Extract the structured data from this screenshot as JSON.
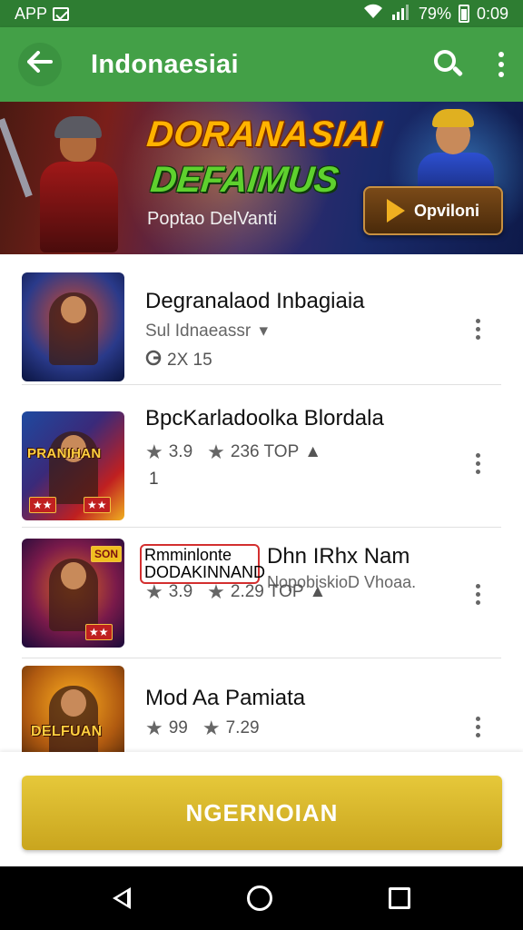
{
  "status_bar": {
    "left_text": "APP",
    "battery": "79%",
    "time": "0:09"
  },
  "app_bar": {
    "title": "Indonaesiai"
  },
  "banner": {
    "title_line1": "DORANASIAI",
    "title_line2": "DEFAIMUS",
    "subtitle": "Poptao DelVanti",
    "cta_label": "Opviloni"
  },
  "apps": [
    {
      "title": "Degranalaod Inbagiaia",
      "subtitle": "Sul Idnaeassr",
      "meta": "2X 15"
    },
    {
      "title": "BpcKarladoolka Blordala",
      "rating": "3.9",
      "downloads": "236 TOP",
      "extra": "1",
      "thumb_text": "PRANIHAN"
    },
    {
      "title_boxed": "Rmminlonte DODAKINNAND",
      "title": "Dhn IRhx Nam",
      "subtitle": "NopobiskioD Vhoaa.",
      "rating": "3.9",
      "downloads": "2.29 TOP",
      "thumb_text": "SON"
    },
    {
      "title": "Mod Aa Pamiata",
      "rating": "99",
      "downloads": "7.29",
      "thumb_text": "DELFUAN"
    }
  ],
  "bottom_cta": {
    "label": "NGERNOIAN"
  },
  "colors": {
    "status_bar": "#2e7d32",
    "app_bar": "#43a047",
    "cta": "#d6b52a"
  }
}
